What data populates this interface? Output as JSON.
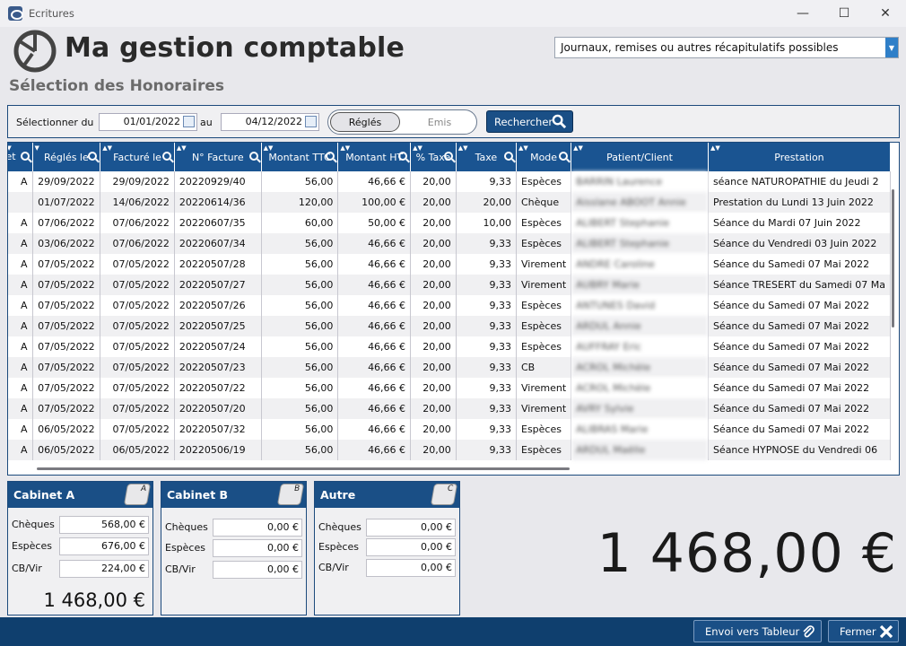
{
  "window": {
    "title": "Ecritures"
  },
  "app": {
    "title": "Ma gestion comptable",
    "subtitle": "Sélection des Honoraires"
  },
  "journal_select": {
    "value": "Journaux, remises ou autres récapitulatifs possibles"
  },
  "filter": {
    "label_from": "Sélectionner du",
    "date_from": "01/01/2022",
    "label_to": "au",
    "date_to": "04/12/2022",
    "toggle_on": "Réglés",
    "toggle_off": "Emis",
    "search_label": "Rechercher"
  },
  "table": {
    "headers": [
      "net",
      "Réglés le",
      "Facturé le",
      "N° Facture",
      "Montant TTC",
      "Montant HT",
      "% Taxe",
      "Taxe",
      "Mode",
      "Patient/Client",
      "Prestation"
    ],
    "rows": [
      [
        "A",
        "29/09/2022",
        "29/09/2022",
        "20220929/40",
        "56,00",
        "46,66 €",
        "20,00",
        "9,33",
        "Espèces",
        "BARRIN Laurence",
        "séance NATUROPATHIE du Jeudi 2"
      ],
      [
        "",
        "01/07/2022",
        "14/06/2022",
        "20220614/36",
        "120,00",
        "100,00 €",
        "20,00",
        "20,00",
        "Chèque",
        "Aisslane ABOOT Annie",
        "Prestation du Lundi 13 Juin 2022"
      ],
      [
        "A",
        "07/06/2022",
        "07/06/2022",
        "20220607/35",
        "60,00",
        "50,00 €",
        "20,00",
        "10,00",
        "Espèces",
        "ALIBERT Stephanie",
        "Séance du Mardi 07 Juin 2022"
      ],
      [
        "A",
        "03/06/2022",
        "07/06/2022",
        "20220607/34",
        "56,00",
        "46,66 €",
        "20,00",
        "9,33",
        "Espèces",
        "ALIBERT Stephanie",
        "Séance du Vendredi 03 Juin 2022"
      ],
      [
        "A",
        "07/05/2022",
        "07/05/2022",
        "20220507/28",
        "56,00",
        "46,66 €",
        "20,00",
        "9,33",
        "Virement",
        "ANDRE Caroline",
        "Séance du Samedi 07 Mai 2022"
      ],
      [
        "A",
        "07/05/2022",
        "07/05/2022",
        "20220507/27",
        "56,00",
        "46,66 €",
        "20,00",
        "9,33",
        "Virement",
        "AUBRY Marie",
        "Séance TRESERT du Samedi 07 Ma"
      ],
      [
        "A",
        "07/05/2022",
        "07/05/2022",
        "20220507/26",
        "56,00",
        "46,66 €",
        "20,00",
        "9,33",
        "Espèces",
        "ANTUNES David",
        "Séance du Samedi 07 Mai 2022"
      ],
      [
        "A",
        "07/05/2022",
        "07/05/2022",
        "20220507/25",
        "56,00",
        "46,66 €",
        "20,00",
        "9,33",
        "Espèces",
        "ARDUL Annie",
        "Séance du Samedi 07 Mai 2022"
      ],
      [
        "A",
        "07/05/2022",
        "07/05/2022",
        "20220507/24",
        "56,00",
        "46,66 €",
        "20,00",
        "9,33",
        "Espèces",
        "AUFFRAY Eric",
        "Séance du Samedi 07 Mai 2022"
      ],
      [
        "A",
        "07/05/2022",
        "07/05/2022",
        "20220507/23",
        "56,00",
        "46,66 €",
        "20,00",
        "9,33",
        "CB",
        "ACROL Michèle",
        "Séance du Samedi 07 Mai 2022"
      ],
      [
        "A",
        "07/05/2022",
        "07/05/2022",
        "20220507/22",
        "56,00",
        "46,66 €",
        "20,00",
        "9,33",
        "Virement",
        "ACROL Michèle",
        "Séance du Samedi 07 Mai 2022"
      ],
      [
        "A",
        "07/05/2022",
        "07/05/2022",
        "20220507/20",
        "56,00",
        "46,66 €",
        "20,00",
        "9,33",
        "Virement",
        "AVRY Sylvie",
        "Séance du Samedi 07 Mai 2022"
      ],
      [
        "A",
        "06/05/2022",
        "07/05/2022",
        "20220507/32",
        "56,00",
        "46,66 €",
        "20,00",
        "9,33",
        "Espèces",
        "ALIBRAS Marie",
        "Séance du Samedi 07 Mai 2022"
      ],
      [
        "A",
        "06/05/2022",
        "06/05/2022",
        "20220506/19",
        "56,00",
        "46,66 €",
        "20,00",
        "9,33",
        "Espèces",
        "ARDUL Maëlle",
        "Séance HYPNOSE du Vendredi 06"
      ]
    ]
  },
  "cabinets": [
    {
      "title": "Cabinet A",
      "badge": "A",
      "cheques_label": "Chèques",
      "cheques": "568,00 €",
      "especes_label": "Espèces",
      "especes": "676,00 €",
      "cbvir_label": "CB/Vir",
      "cbvir": "224,00 €",
      "total": "1 468,00 €"
    },
    {
      "title": "Cabinet B",
      "badge": "B",
      "cheques_label": "Chèques",
      "cheques": "0,00 €",
      "especes_label": "Espèces",
      "especes": "0,00 €",
      "cbvir_label": "CB/Vir",
      "cbvir": "0,00 €"
    },
    {
      "title": "Autre",
      "badge": "C",
      "cheques_label": "Chèques",
      "cheques": "0,00 €",
      "especes_label": "Espèces",
      "especes": "0,00 €",
      "cbvir_label": "CB/Vir",
      "cbvir": "0,00 €"
    }
  ],
  "grand_total": "1 468,00 €",
  "footer": {
    "export_label": "Envoi vers Tableur",
    "close_label": "Fermer"
  },
  "colors": {
    "accent": "#1a4f86",
    "header": "#1a5491"
  }
}
